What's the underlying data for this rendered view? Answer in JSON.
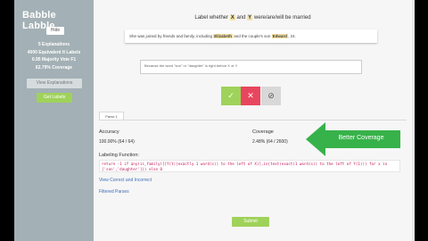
{
  "app": {
    "title": "Babble Labble",
    "back_label": "Hide"
  },
  "stats": [
    "5 Explanations",
    "4000 Equivalent It Labels",
    "0.95 Majority Vote F1",
    "62.79% Coverage"
  ],
  "sidebar": {
    "explanations_button": "View Explanations",
    "label_button": "Get Labels"
  },
  "prompt": {
    "prefix": "Label whether",
    "x": "X",
    "mid": "and",
    "y": "Y",
    "suffix": "were/are/will be married"
  },
  "sentence": {
    "before": "She was joined by friends and family, including",
    "entity_x": "Elizabeth",
    "middle": "and the couple's son",
    "entity_y": "Edward",
    "after": ", 24."
  },
  "explanation": {
    "text": "Because the word \"son\" or \"daughter\" is right before X or Y"
  },
  "votes": {
    "yes": "✓",
    "no": "✕",
    "abstain": "⊘"
  },
  "tab": {
    "label": "Parse 1"
  },
  "metrics": {
    "accuracy_label": "Accuracy",
    "accuracy_value": "100.00% (64 / 64)",
    "coverage_label": "Coverage",
    "coverage_value": "2.48% (64 / 2600)"
  },
  "labeling_function": {
    "title": "Labeling Function:",
    "code": "return -1 if any(is_family([[Y(t)(exactly 1 word(s)) to the left of X)],in(text(exact(1 word(s)) to the left of Y(1))) for x in ['son','daughter'])) else 0"
  },
  "links": {
    "correct_incorrect": "View Correct and Incorrect",
    "filtered_parses": "Filtered Parses"
  },
  "submit_label": "Submit",
  "callout": {
    "text": "Better Coverage",
    "color": "#37b24a"
  },
  "colors": {
    "sidebar": "#a3b0b5",
    "accent_green": "#9fd25a",
    "accent_red": "#e8465e",
    "highlight": "#f3e3a8",
    "link": "#3d6fb6"
  }
}
